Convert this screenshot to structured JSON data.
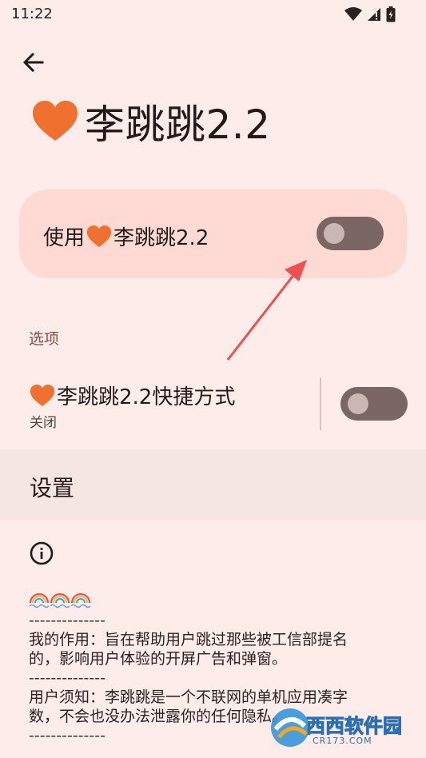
{
  "status_bar": {
    "time": "11:22",
    "icons": [
      "wifi-icon",
      "signal-icon",
      "battery-icon"
    ]
  },
  "header": {
    "back_icon": "arrow-left-icon",
    "app_name": "李跳跳2.2"
  },
  "main_toggle": {
    "label_prefix": "使用",
    "label_name": "李跳跳2.2",
    "enabled": false
  },
  "options": {
    "section_title": "选项",
    "shortcut": {
      "title_name": "李跳跳2.2",
      "title_suffix": "快捷方式",
      "subtitle": "关闭",
      "enabled": false
    }
  },
  "settings": {
    "title": "设置"
  },
  "about": {
    "info_icon": "info-icon",
    "emoji_line": [
      "rainbow-icon",
      "rainbow-icon",
      "rainbow-icon"
    ],
    "separator": "--------------",
    "paragraph1_line1": "我的作用：旨在帮助用户跳过那些被工信部提名",
    "paragraph1_line2": "的，影响用户体验的开屏广告和弹窗。",
    "paragraph2_line1": "用户须知：李跳跳是一个不联网的单机应用凑字",
    "paragraph2_line2": "数，不会也没办法泄露你的任何隐私。"
  },
  "watermark": {
    "brand": "西西",
    "text": "软件园",
    "domain": "CR173.COM"
  },
  "colors": {
    "background": "#fdecea",
    "card": "#ffdad5",
    "heart": "#f07030",
    "switch_track": "#7a6663",
    "accent_label": "#8f4c43",
    "annotation_arrow": "#ee5050"
  }
}
